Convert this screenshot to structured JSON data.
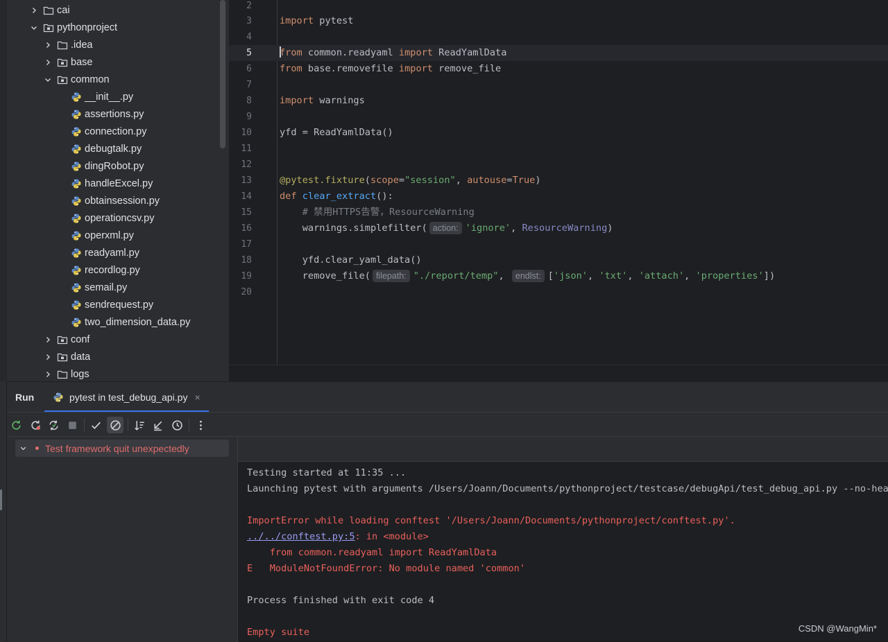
{
  "project_tree": {
    "items": [
      {
        "label": "cai",
        "type": "folder",
        "expanded": false,
        "indent": 0
      },
      {
        "label": "pythonproject",
        "type": "folder-module",
        "expanded": true,
        "indent": 0
      },
      {
        "label": ".idea",
        "type": "folder",
        "expanded": false,
        "indent": 1
      },
      {
        "label": "base",
        "type": "folder-module",
        "expanded": false,
        "indent": 1
      },
      {
        "label": "common",
        "type": "folder-module",
        "expanded": true,
        "indent": 1
      },
      {
        "label": "__init__.py",
        "type": "python-file",
        "indent": 2
      },
      {
        "label": "assertions.py",
        "type": "python-file",
        "indent": 2
      },
      {
        "label": "connection.py",
        "type": "python-file",
        "indent": 2
      },
      {
        "label": "debugtalk.py",
        "type": "python-file",
        "indent": 2
      },
      {
        "label": "dingRobot.py",
        "type": "python-file",
        "indent": 2
      },
      {
        "label": "handleExcel.py",
        "type": "python-file",
        "indent": 2
      },
      {
        "label": "obtainsession.py",
        "type": "python-file",
        "indent": 2
      },
      {
        "label": "operationcsv.py",
        "type": "python-file",
        "indent": 2
      },
      {
        "label": "operxml.py",
        "type": "python-file",
        "indent": 2
      },
      {
        "label": "readyaml.py",
        "type": "python-file",
        "indent": 2
      },
      {
        "label": "recordlog.py",
        "type": "python-file",
        "indent": 2
      },
      {
        "label": "semail.py",
        "type": "python-file",
        "indent": 2
      },
      {
        "label": "sendrequest.py",
        "type": "python-file",
        "indent": 2
      },
      {
        "label": "two_dimension_data.py",
        "type": "python-file",
        "indent": 2
      },
      {
        "label": "conf",
        "type": "folder-module",
        "expanded": false,
        "indent": 1
      },
      {
        "label": "data",
        "type": "folder-module",
        "expanded": false,
        "indent": 1
      },
      {
        "label": "logs",
        "type": "folder",
        "expanded": false,
        "indent": 1
      }
    ]
  },
  "editor": {
    "current_line": 5,
    "line_numbers": [
      "2",
      "3",
      "4",
      "5",
      "6",
      "7",
      "8",
      "9",
      "10",
      "11",
      "12",
      "13",
      "14",
      "15",
      "16",
      "17",
      "18",
      "19",
      "20"
    ],
    "code": {
      "l3_kw": "import",
      "l3_rest": " pytest",
      "l5_kw1": "from",
      "l5_mod": " common.readyaml ",
      "l5_kw2": "import",
      "l5_name": " ReadYamlData",
      "l6_kw1": "from",
      "l6_mod": " base.removefile ",
      "l6_kw2": "import",
      "l6_name": " remove_file",
      "l8_kw": "import",
      "l8_rest": " warnings",
      "l10": "yfd = ReadYamlData()",
      "l13_dec": "@pytest.fixture",
      "l13_p1": "(",
      "l13_scope": "scope",
      "l13_eq1": "=",
      "l13_str": "\"session\"",
      "l13_comma": ", ",
      "l13_auto": "autouse",
      "l13_eq2": "=",
      "l13_true": "True",
      "l13_end": ")",
      "l14_kw": "def",
      "l14_fn": " clear_extract",
      "l14_end": "():",
      "l15_cmt": "    # 禁用HTTPS告警，ResourceWarning",
      "l16_a": "    warnings.simplefilter(",
      "l16_hint": "action:",
      "l16_str": "'ignore'",
      "l16_comma": ", ",
      "l16_cls": "ResourceWarning",
      "l16_end": ")",
      "l18": "    yfd.clear_yaml_data()",
      "l19_a": "    remove_file(",
      "l19_hint1": "filepath:",
      "l19_str1": "\"./report/temp\"",
      "l19_comma": ", ",
      "l19_hint2": "endlst:",
      "l19_b": "[",
      "l19_s1": "'json'",
      "l19_s2": "'txt'",
      "l19_s3": "'attach'",
      "l19_s4": "'properties'",
      "l19_sep": ", ",
      "l19_end": "])"
    }
  },
  "run_panel": {
    "title": "Run",
    "tab_label": "pytest in test_debug_api.py",
    "tab_close": "×",
    "test_tree_item": "Test framework quit unexpectedly",
    "toolbar_icons": [
      "rerun-icon",
      "rerun-failed-icon",
      "toggle-auto-test-icon",
      "stop-icon",
      "show-passed-icon",
      "show-ignored-icon",
      "sort-icon",
      "collapse-icon",
      "history-icon",
      "more-icon"
    ]
  },
  "console": {
    "l1": "Testing started at 11:35 ...",
    "l2": "Launching pytest with arguments /Users/Joann/Documents/pythonproject/testcase/debugApi/test_debug_api.py --no-header",
    "l3": "ImportError while loading conftest '/Users/Joann/Documents/pythonproject/conftest.py'.",
    "l4_link": "../../conftest.py:5",
    "l4_rest": ": in <module>",
    "l5": "    from common.readyaml import ReadYamlData",
    "l6": "E   ModuleNotFoundError: No module named 'common'",
    "l7": "Process finished with exit code 4",
    "l8": "Empty suite"
  },
  "watermark": "CSDN @WangMin*",
  "colors": {
    "error": "#e9605b",
    "accent": "#3574f0",
    "keyword": "#cf8e6d",
    "string": "#6aab73"
  }
}
